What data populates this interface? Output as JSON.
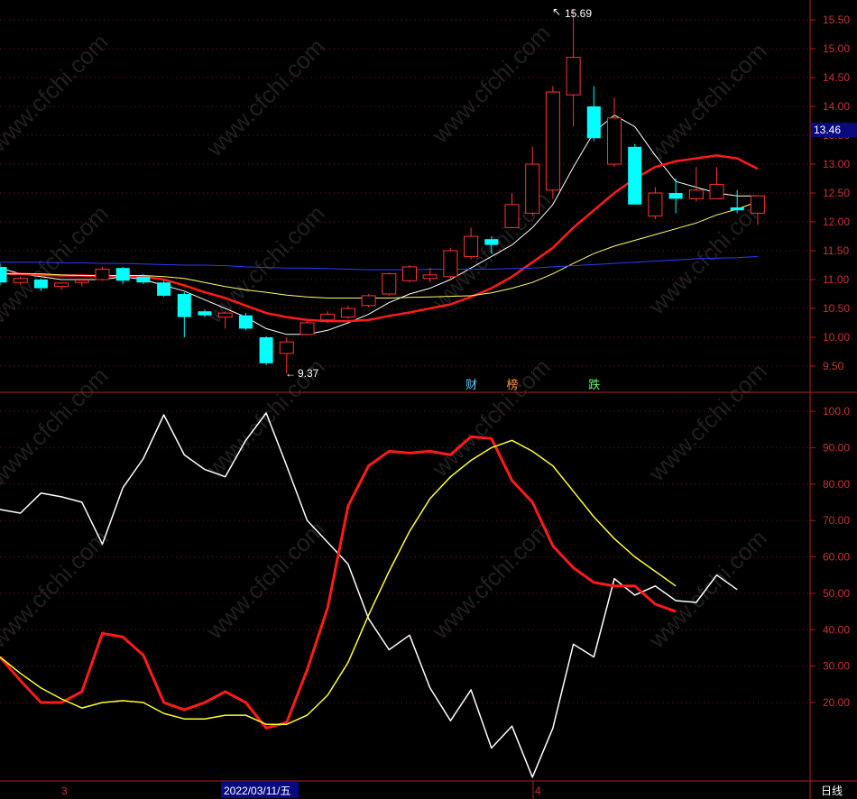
{
  "chart_data": [
    {
      "type": "candlestick",
      "panel": "price",
      "yticks": [
        "15.50",
        "15.00",
        "14.50",
        "14.00",
        "13.50",
        "13.00",
        "12.50",
        "12.00",
        "11.50",
        "11.00",
        "10.50",
        "10.00",
        "9.50"
      ],
      "ylim": [
        9.3,
        15.8
      ],
      "current_price_tag": "13.46",
      "annotations": {
        "high_label": "15.69",
        "low_label": "9.37"
      },
      "event_markers": [
        {
          "text": "财",
          "color": "#66ccff",
          "index": 23
        },
        {
          "text": "榜",
          "color": "#ff9933",
          "index": 25
        },
        {
          "text": "跌",
          "color": "#66ff66",
          "index": 29
        }
      ],
      "candles": [
        {
          "o": 11.22,
          "h": 11.28,
          "c": 10.95,
          "l": 10.9
        },
        {
          "o": 10.95,
          "h": 11.05,
          "c": 11.02,
          "l": 10.9
        },
        {
          "o": 11.0,
          "h": 11.02,
          "c": 10.85,
          "l": 10.8
        },
        {
          "o": 10.88,
          "h": 10.95,
          "c": 10.94,
          "l": 10.82
        },
        {
          "o": 10.95,
          "h": 11.02,
          "c": 10.99,
          "l": 10.88
        },
        {
          "o": 11.0,
          "h": 11.22,
          "c": 11.18,
          "l": 10.98
        },
        {
          "o": 11.2,
          "h": 11.22,
          "c": 10.98,
          "l": 10.92
        },
        {
          "o": 11.05,
          "h": 11.1,
          "c": 10.95,
          "l": 10.92
        },
        {
          "o": 10.95,
          "h": 10.98,
          "c": 10.72,
          "l": 10.7
        },
        {
          "o": 10.75,
          "h": 10.78,
          "c": 10.35,
          "l": 10.0
        },
        {
          "o": 10.45,
          "h": 10.48,
          "c": 10.38,
          "l": 10.35
        },
        {
          "o": 10.35,
          "h": 10.45,
          "c": 10.42,
          "l": 10.15
        },
        {
          "o": 10.38,
          "h": 10.42,
          "c": 10.15,
          "l": 10.12
        },
        {
          "o": 10.0,
          "h": 10.02,
          "c": 9.55,
          "l": 9.52
        },
        {
          "o": 9.72,
          "h": 10.0,
          "c": 9.92,
          "l": 9.37
        },
        {
          "o": 10.05,
          "h": 10.28,
          "c": 10.25,
          "l": 10.05
        },
        {
          "o": 10.3,
          "h": 10.45,
          "c": 10.4,
          "l": 10.25
        },
        {
          "o": 10.35,
          "h": 10.55,
          "c": 10.5,
          "l": 10.32
        },
        {
          "o": 10.55,
          "h": 10.75,
          "c": 10.72,
          "l": 10.52
        },
        {
          "o": 10.75,
          "h": 11.12,
          "c": 11.1,
          "l": 10.72
        },
        {
          "o": 10.98,
          "h": 11.25,
          "c": 11.22,
          "l": 10.95
        },
        {
          "o": 11.02,
          "h": 11.2,
          "c": 11.08,
          "l": 10.95
        },
        {
          "o": 11.05,
          "h": 11.55,
          "c": 11.5,
          "l": 11.0
        },
        {
          "o": 11.4,
          "h": 11.9,
          "c": 11.75,
          "l": 11.35
        },
        {
          "o": 11.7,
          "h": 11.75,
          "c": 11.6,
          "l": 11.45
        },
        {
          "o": 11.9,
          "h": 12.5,
          "c": 12.3,
          "l": 11.9
        },
        {
          "o": 12.15,
          "h": 13.3,
          "c": 13.0,
          "l": 12.1
        },
        {
          "o": 12.55,
          "h": 14.35,
          "c": 14.25,
          "l": 12.4
        },
        {
          "o": 14.2,
          "h": 15.69,
          "c": 14.85,
          "l": 13.65
        },
        {
          "o": 14.0,
          "h": 14.35,
          "c": 13.45,
          "l": 13.4
        },
        {
          "o": 13.0,
          "h": 14.15,
          "c": 13.8,
          "l": 12.95
        },
        {
          "o": 13.3,
          "h": 13.35,
          "c": 12.3,
          "l": 12.3
        },
        {
          "o": 12.1,
          "h": 12.6,
          "c": 12.5,
          "l": 12.05
        },
        {
          "o": 12.5,
          "h": 12.75,
          "c": 12.4,
          "l": 12.15
        },
        {
          "o": 12.4,
          "h": 12.95,
          "c": 12.55,
          "l": 12.35
        },
        {
          "o": 12.4,
          "h": 12.95,
          "c": 12.65,
          "l": 12.4
        },
        {
          "o": 12.25,
          "h": 12.55,
          "c": 12.2,
          "l": 12.15
        },
        {
          "o": 12.15,
          "h": 12.4,
          "c": 12.45,
          "l": 11.95
        }
      ],
      "ma_lines": [
        {
          "color": "#ffffff",
          "width": 1,
          "values": [
            11.2,
            11.1,
            11.05,
            11.0,
            11.0,
            11.0,
            11.05,
            11.0,
            10.9,
            10.8,
            10.65,
            10.5,
            10.35,
            10.15,
            10.05,
            10.05,
            10.12,
            10.25,
            10.4,
            10.6,
            10.75,
            10.85,
            11.0,
            11.2,
            11.4,
            11.6,
            11.9,
            12.3,
            12.95,
            13.55,
            13.85,
            13.65,
            13.15,
            12.7,
            12.6,
            12.5,
            12.45,
            12.45
          ]
        },
        {
          "color": "#ff1a1a",
          "width": 2.5,
          "values": [
            11.1,
            11.1,
            11.08,
            11.07,
            11.07,
            11.06,
            11.06,
            11.05,
            11.0,
            10.9,
            10.78,
            10.68,
            10.55,
            10.42,
            10.35,
            10.3,
            10.28,
            10.28,
            10.3,
            10.37,
            10.43,
            10.5,
            10.57,
            10.7,
            10.85,
            11.05,
            11.3,
            11.55,
            11.9,
            12.2,
            12.5,
            12.75,
            12.95,
            13.05,
            13.1,
            13.15,
            13.1,
            12.92
          ]
        },
        {
          "color": "#ffff66",
          "width": 1,
          "values": [
            11.1,
            11.1,
            11.1,
            11.08,
            11.07,
            11.07,
            11.07,
            11.07,
            11.05,
            11.02,
            10.95,
            10.88,
            10.82,
            10.78,
            10.73,
            10.7,
            10.68,
            10.68,
            10.68,
            10.68,
            10.69,
            10.7,
            10.71,
            10.72,
            10.77,
            10.85,
            10.95,
            11.1,
            11.28,
            11.45,
            11.58,
            11.68,
            11.78,
            11.88,
            11.98,
            12.12,
            12.22,
            12.35
          ]
        },
        {
          "color": "#2a3cff",
          "width": 1,
          "values": [
            11.3,
            11.3,
            11.3,
            11.29,
            11.29,
            11.28,
            11.28,
            11.27,
            11.26,
            11.25,
            11.25,
            11.24,
            11.22,
            11.21,
            11.2,
            11.2,
            11.19,
            11.18,
            11.17,
            11.17,
            11.17,
            11.18,
            11.18,
            11.18,
            11.18,
            11.19,
            11.2,
            11.22,
            11.24,
            11.26,
            11.28,
            11.3,
            11.32,
            11.34,
            11.36,
            11.37,
            11.38,
            11.4
          ]
        }
      ]
    },
    {
      "type": "line",
      "panel": "indicator",
      "yticks": [
        "100.0",
        "90.00",
        "80.00",
        "70.00",
        "60.00",
        "50.00",
        "40.00",
        "30.00",
        "20.00"
      ],
      "ylim": [
        8.0,
        105.0
      ],
      "series": [
        {
          "color": "#ffffff",
          "width": 1.5,
          "values": [
            73,
            72,
            77.5,
            76.5,
            75,
            63.5,
            79,
            87,
            99,
            88,
            84,
            82,
            92,
            99.5,
            85,
            70,
            64,
            58,
            43,
            34.5,
            38.5,
            24,
            15,
            23.5,
            7.5,
            13.5,
            -0.5,
            13,
            36,
            32.5,
            54,
            49.5,
            52,
            48,
            47.5,
            55,
            51
          ]
        },
        {
          "color": "#ff1a1a",
          "width": 3,
          "values": [
            32.5,
            26,
            20,
            20,
            23,
            39,
            38,
            33,
            20,
            18,
            20,
            23,
            20,
            13,
            14.5,
            29,
            46,
            74,
            85,
            89,
            88.5,
            89,
            88,
            93,
            92.5,
            81,
            75,
            63,
            57,
            53,
            52,
            52,
            47,
            45
          ]
        },
        {
          "color": "#ffff33",
          "width": 1.5,
          "values": [
            32.5,
            28,
            24,
            21,
            18.5,
            20,
            20.5,
            20,
            17,
            15.5,
            15.5,
            16.5,
            16.5,
            14,
            14,
            16.5,
            22,
            31,
            44,
            56,
            67,
            76,
            82,
            86.5,
            90,
            92,
            89,
            85,
            78,
            71,
            65,
            60,
            56,
            52
          ]
        }
      ]
    }
  ],
  "footer": {
    "date_tag": "2022/03/11/五",
    "month_tag_1": "3",
    "month_tag_2": "4",
    "period": "日线"
  },
  "watermark": "www.cfchi.com"
}
